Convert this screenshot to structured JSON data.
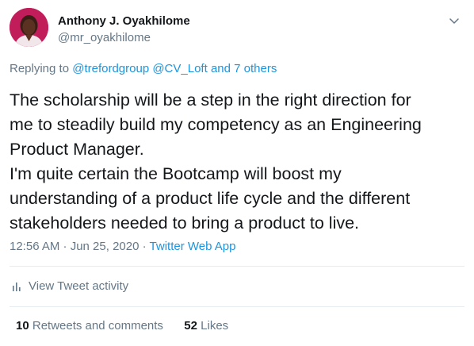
{
  "tweet": {
    "author_name": "Anthony J. Oyakhilome",
    "author_handle": "@mr_oyakhilome",
    "replying_prefix": "Replying to",
    "replying_mentions": "@trefordgroup @CV_Loft",
    "replying_and": "and",
    "replying_others": "7 others",
    "text_lines": [
      "The scholarship will be a step in the right direction for",
      "me to steadily build my competency as an Engineering",
      "Product Manager.",
      "I'm quite certain the Bootcamp will boost my",
      "understanding of a product life cycle and the different",
      "stakeholders needed to bring a product to live."
    ],
    "timestamp": "12:56 AM · Jun 25, 2020",
    "separator": "·",
    "source_app": "Twitter Web App",
    "activity_label": "View Tweet activity",
    "retweets_count": "10",
    "retweets_label": "Retweets and comments",
    "likes_count": "52",
    "likes_label": "Likes"
  },
  "icons": {
    "caret": "chevron-down-icon",
    "activity": "bar-chart-icon"
  },
  "colors": {
    "link": "#1b95e0",
    "secondary_text": "#657786",
    "primary_text": "#14171a",
    "divider": "#e6ecf0",
    "avatar_bg": "#c21d5b"
  }
}
